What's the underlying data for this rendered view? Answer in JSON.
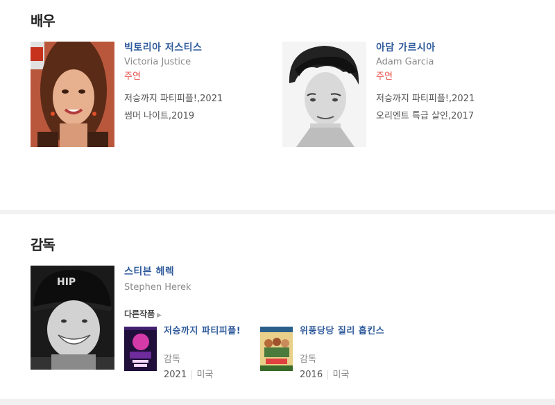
{
  "actors_section": {
    "title": "배우",
    "actors": [
      {
        "name_ko": "빅토리아 저스티스",
        "name_en": "Victoria Justice",
        "role": "주연",
        "works": [
          "저승까지 파티피플!,2021",
          "썸머 나이트,2019"
        ]
      },
      {
        "name_ko": "아담 가르시아",
        "name_en": "Adam Garcia",
        "role": "주연",
        "works": [
          "저승까지 파티피플!,2021",
          "오리엔트 특급 살인,2017"
        ]
      }
    ]
  },
  "director_section": {
    "title": "감독",
    "director": {
      "name_ko": "스티븐 헤렉",
      "name_en": "Stephen Herek",
      "other_works_label": "다른작품",
      "films": [
        {
          "title": "저승까지 파티피플!",
          "role": "감독",
          "year": "2021",
          "country": "미국"
        },
        {
          "title": "위풍당당 질리 홉킨스",
          "role": "감독",
          "year": "2016",
          "country": "미국"
        }
      ]
    }
  },
  "colors": {
    "link_blue": "#2f5b9c",
    "role_red": "#e8544d",
    "divider": "#f1f1f1"
  }
}
